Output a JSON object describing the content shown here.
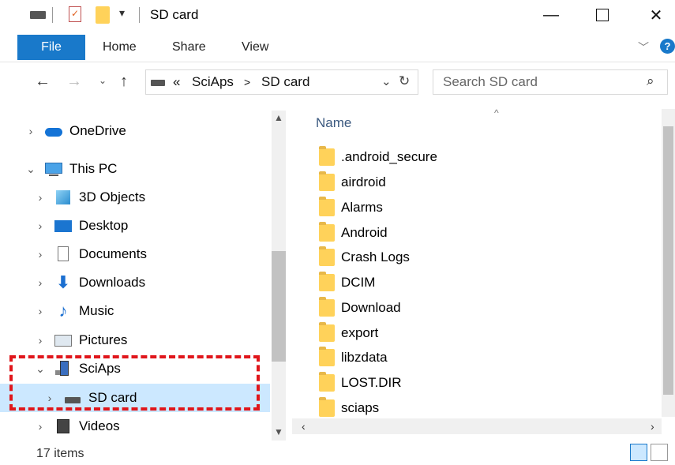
{
  "window": {
    "title": "SD card"
  },
  "ribbon": {
    "tabs": [
      "File",
      "Home",
      "Share",
      "View"
    ]
  },
  "address": {
    "prefix": "«",
    "crumbs": [
      "SciAps",
      "SD card"
    ],
    "separator": ">"
  },
  "search": {
    "placeholder": "Search SD card"
  },
  "nav": {
    "items": [
      {
        "label": "OneDrive",
        "icon": "cloud-icon"
      },
      {
        "label": "This PC",
        "icon": "computer-icon"
      },
      {
        "label": "3D Objects",
        "icon": "cube-icon"
      },
      {
        "label": "Desktop",
        "icon": "desktop-icon"
      },
      {
        "label": "Documents",
        "icon": "documents-icon"
      },
      {
        "label": "Downloads",
        "icon": "download-icon"
      },
      {
        "label": "Music",
        "icon": "music-icon"
      },
      {
        "label": "Pictures",
        "icon": "pictures-icon"
      },
      {
        "label": "SciAps",
        "icon": "device-icon"
      },
      {
        "label": "SD card",
        "icon": "drive-icon"
      },
      {
        "label": "Videos",
        "icon": "videos-icon"
      }
    ]
  },
  "content": {
    "column_name": "Name",
    "files": [
      ".android_secure",
      "airdroid",
      "Alarms",
      "Android",
      "Crash Logs",
      "DCIM",
      "Download",
      "export",
      "libzdata",
      "LOST.DIR",
      "sciaps"
    ]
  },
  "status": {
    "items": "17 items"
  },
  "colors": {
    "accent": "#1979ca",
    "selection": "#cce8ff",
    "highlight": "#e0161b",
    "folder": "#ffd25a"
  }
}
